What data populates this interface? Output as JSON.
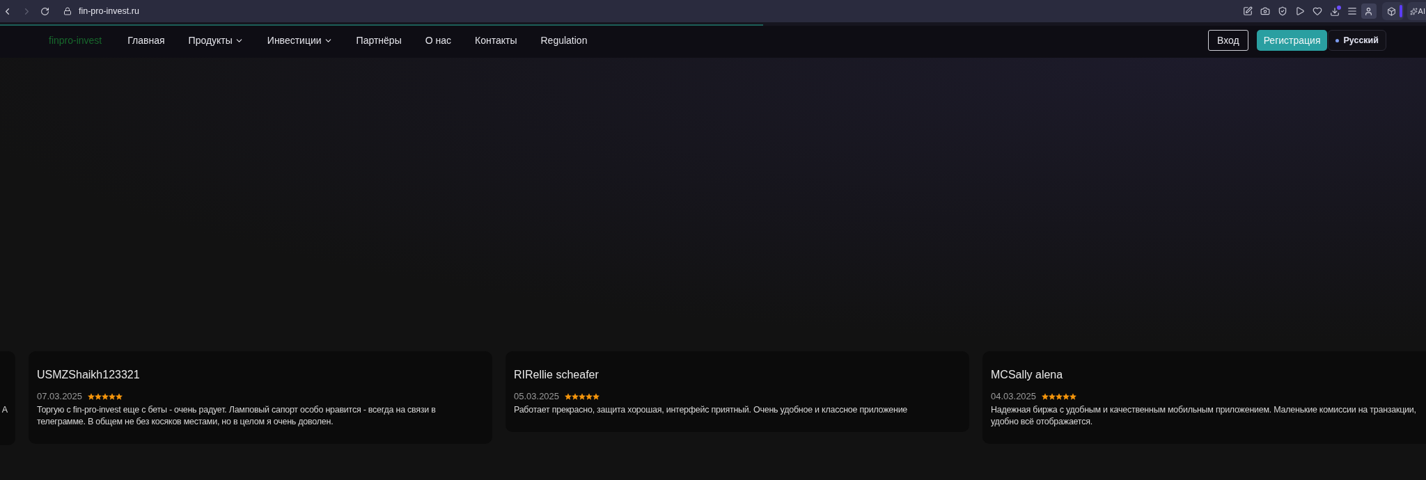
{
  "browser": {
    "back_disabled": false,
    "forward_disabled": true,
    "url": "fin-pro-invest.ru",
    "ai_label": "AI"
  },
  "loading_bar": {
    "level": 0.535
  },
  "header": {
    "logo": "finpro-invest",
    "nav_items": [
      {
        "label": "Главная",
        "has_menu": false
      },
      {
        "label": "Продукты",
        "has_menu": true
      },
      {
        "label": "Инвестиции",
        "has_menu": true
      },
      {
        "label": "Партнёры",
        "has_menu": false
      },
      {
        "label": "О нас",
        "has_menu": false
      },
      {
        "label": "Контакты",
        "has_menu": false
      },
      {
        "label": "Regulation",
        "has_menu": false
      }
    ],
    "login": "Вход",
    "register": "Регистрация",
    "language": "Русский"
  },
  "reviews": [
    {
      "kind": "partial",
      "text": "A"
    },
    {
      "kind": "full",
      "name": "USMZShaikh123321",
      "date": "07.03.2025",
      "stars": 5,
      "text": "Торгую с fin-pro-invest еще с беты - очень радует. Ламповый сапорт особо нравится - всегда на связи в телеграмме. В общем не без косяков местами, но в целом я очень доволен."
    },
    {
      "kind": "full",
      "name": "RIRellie scheafer",
      "date": "05.03.2025",
      "stars": 5,
      "text": "Работает прекрасно, защита хорошая, интерфейс приятный. Очень удобное и классное приложение"
    },
    {
      "kind": "full",
      "name": "MCSally alena",
      "date": "04.03.2025",
      "stars": 5,
      "text": "Надежная биржа с удобным и качественным мобильным приложением. Маленькие комиссии на транзакции, удобно всё отображается."
    }
  ]
}
